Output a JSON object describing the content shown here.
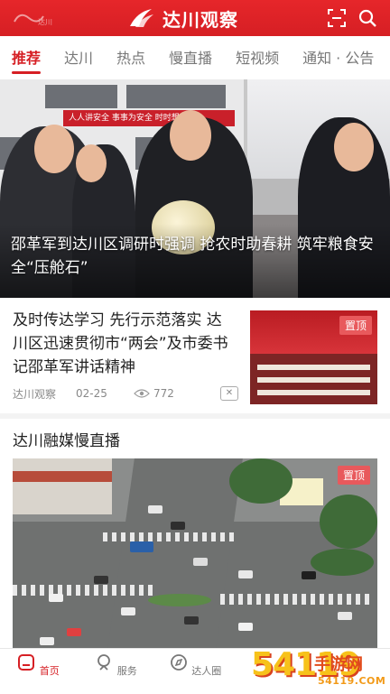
{
  "app": {
    "name": "达川观察",
    "corner_logo": "达川"
  },
  "header": {
    "scan_icon": "scan-icon",
    "search_icon": "search-icon"
  },
  "tabs": [
    {
      "label": "推荐",
      "active": true
    },
    {
      "label": "达川",
      "active": false
    },
    {
      "label": "热点",
      "active": false
    },
    {
      "label": "慢直播",
      "active": false
    },
    {
      "label": "短视频",
      "active": false
    },
    {
      "label": "通知 · 公告",
      "active": false
    }
  ],
  "hero": {
    "banner_text": "人人讲安全  事事为安全  时时想安全",
    "caption": "邵革军到达川区调研时强调 抢农时助春耕 筑牢粮食安全“压舱石”"
  },
  "news": {
    "title": "及时传达学习 先行示范落实 达川区迅速贯彻市“两会”及市委书记邵革军讲话精神",
    "source": "达川观察",
    "date": "02-25",
    "views": "772",
    "pin_label": "置顶"
  },
  "live": {
    "heading": "达川融媒慢直播",
    "pin_label": "置顶"
  },
  "bottom_nav": [
    {
      "label": "首页",
      "icon": "home-icon",
      "active": true
    },
    {
      "label": "服务",
      "icon": "service-icon",
      "active": false
    },
    {
      "label": "达人圈",
      "icon": "compass-icon",
      "active": false
    }
  ],
  "watermark": {
    "num": "54119",
    "name": "手游网",
    "url": "54119.COM"
  },
  "colors": {
    "brand_red": "#d61f24",
    "pin_red": "#e8595c"
  }
}
